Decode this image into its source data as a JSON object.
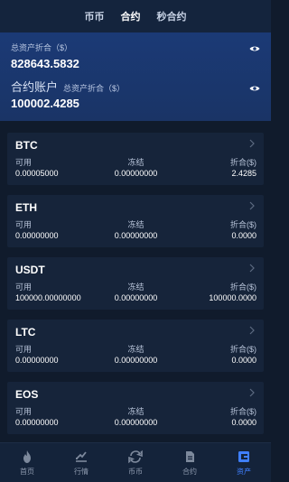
{
  "tabs": [
    {
      "label": "币币",
      "active": false
    },
    {
      "label": "合约",
      "active": true
    },
    {
      "label": "秒合约",
      "active": false
    }
  ],
  "summary": {
    "total_label": "总资产折合（$）",
    "total_value": "828643.5832",
    "contract_label": "合约账户",
    "contract_sub_label": "总资产折合（$）",
    "contract_value": "100002.4285"
  },
  "columns": {
    "available": "可用",
    "frozen": "冻结",
    "equiv": "折合($)"
  },
  "coins": [
    {
      "name": "BTC",
      "available": "0.00005000",
      "frozen": "0.00000000",
      "equiv": "2.4285"
    },
    {
      "name": "ETH",
      "available": "0.00000000",
      "frozen": "0.00000000",
      "equiv": "0.0000"
    },
    {
      "name": "USDT",
      "available": "100000.00000000",
      "frozen": "0.00000000",
      "equiv": "100000.0000"
    },
    {
      "name": "LTC",
      "available": "0.00000000",
      "frozen": "0.00000000",
      "equiv": "0.0000"
    },
    {
      "name": "EOS",
      "available": "0.00000000",
      "frozen": "0.00000000",
      "equiv": "0.0000"
    }
  ],
  "nav": [
    {
      "label": "首页",
      "icon": "flame-icon"
    },
    {
      "label": "行情",
      "icon": "chart-icon"
    },
    {
      "label": "币币",
      "icon": "exchange-icon"
    },
    {
      "label": "合约",
      "icon": "document-icon"
    },
    {
      "label": "资产",
      "icon": "wallet-icon",
      "active": true
    }
  ],
  "colors": {
    "accent": "#3f7fff",
    "header_blue": "#1b3a76",
    "background": "#101b2c",
    "card": "#16243a"
  }
}
